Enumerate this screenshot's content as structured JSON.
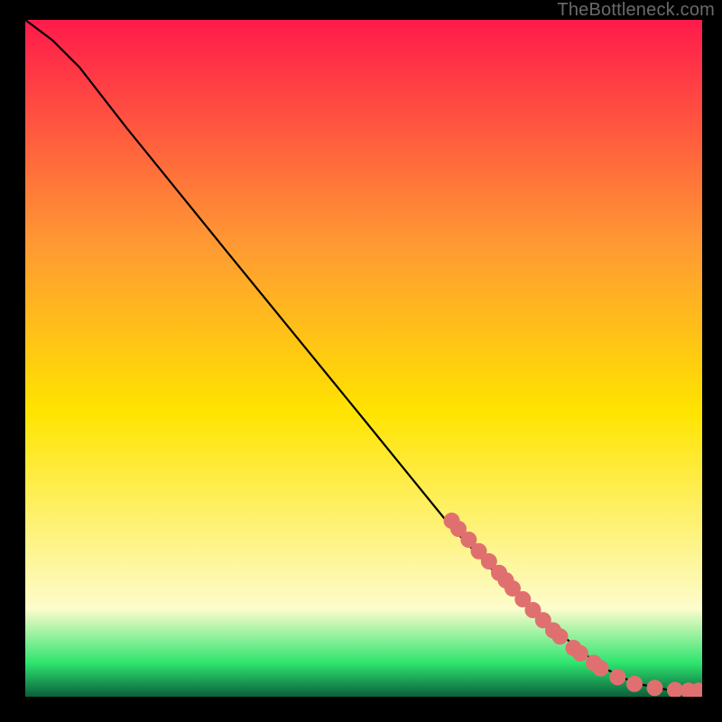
{
  "watermark": "TheBottleneck.com",
  "colors": {
    "background": "#000000",
    "line": "#000000",
    "marker_fill": "#e07070",
    "marker_stroke": "#e07070",
    "gradient_top": "#ff1a4b",
    "gradient_upper_mid": "#ff9933",
    "gradient_mid": "#ffe400",
    "gradient_low_mid": "#fdfccc",
    "gradient_green": "#2ee56f",
    "gradient_bottom": "#0a5f3a"
  },
  "chart_data": {
    "type": "line",
    "title": "",
    "xlabel": "",
    "ylabel": "",
    "xlim": [
      0,
      100
    ],
    "ylim": [
      0,
      100
    ],
    "line_points": [
      {
        "x": 0,
        "y": 100
      },
      {
        "x": 4,
        "y": 97
      },
      {
        "x": 8,
        "y": 93
      },
      {
        "x": 15,
        "y": 84
      },
      {
        "x": 30,
        "y": 65.5
      },
      {
        "x": 50,
        "y": 41
      },
      {
        "x": 63,
        "y": 25
      },
      {
        "x": 75,
        "y": 12.5
      },
      {
        "x": 85,
        "y": 4.5
      },
      {
        "x": 90,
        "y": 2
      },
      {
        "x": 95,
        "y": 1
      },
      {
        "x": 100,
        "y": 1
      }
    ],
    "markers": [
      {
        "x": 63,
        "y": 26.0
      },
      {
        "x": 64,
        "y": 24.8
      },
      {
        "x": 65.5,
        "y": 23.2
      },
      {
        "x": 67,
        "y": 21.5
      },
      {
        "x": 68.5,
        "y": 20.0
      },
      {
        "x": 70,
        "y": 18.3
      },
      {
        "x": 71,
        "y": 17.2
      },
      {
        "x": 72,
        "y": 16.0
      },
      {
        "x": 73.5,
        "y": 14.4
      },
      {
        "x": 75,
        "y": 12.8
      },
      {
        "x": 76.5,
        "y": 11.3
      },
      {
        "x": 78,
        "y": 9.8
      },
      {
        "x": 79,
        "y": 8.9
      },
      {
        "x": 81,
        "y": 7.2
      },
      {
        "x": 82,
        "y": 6.4
      },
      {
        "x": 84,
        "y": 5.0
      },
      {
        "x": 85,
        "y": 4.2
      },
      {
        "x": 87.5,
        "y": 2.9
      },
      {
        "x": 90,
        "y": 1.9
      },
      {
        "x": 93,
        "y": 1.3
      },
      {
        "x": 96,
        "y": 1.0
      },
      {
        "x": 98,
        "y": 0.9
      },
      {
        "x": 99.5,
        "y": 0.9
      }
    ]
  }
}
